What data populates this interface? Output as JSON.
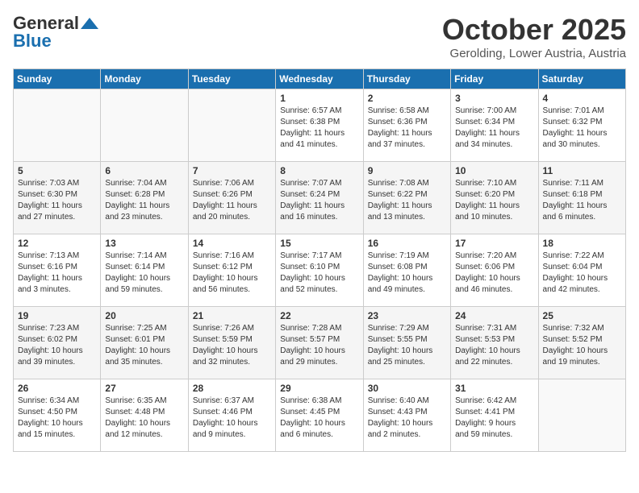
{
  "header": {
    "logo_line1": "General",
    "logo_line2": "Blue",
    "month": "October 2025",
    "location": "Gerolding, Lower Austria, Austria"
  },
  "days_of_week": [
    "Sunday",
    "Monday",
    "Tuesday",
    "Wednesday",
    "Thursday",
    "Friday",
    "Saturday"
  ],
  "weeks": [
    [
      {
        "day": "",
        "content": ""
      },
      {
        "day": "",
        "content": ""
      },
      {
        "day": "",
        "content": ""
      },
      {
        "day": "1",
        "content": "Sunrise: 6:57 AM\nSunset: 6:38 PM\nDaylight: 11 hours\nand 41 minutes."
      },
      {
        "day": "2",
        "content": "Sunrise: 6:58 AM\nSunset: 6:36 PM\nDaylight: 11 hours\nand 37 minutes."
      },
      {
        "day": "3",
        "content": "Sunrise: 7:00 AM\nSunset: 6:34 PM\nDaylight: 11 hours\nand 34 minutes."
      },
      {
        "day": "4",
        "content": "Sunrise: 7:01 AM\nSunset: 6:32 PM\nDaylight: 11 hours\nand 30 minutes."
      }
    ],
    [
      {
        "day": "5",
        "content": "Sunrise: 7:03 AM\nSunset: 6:30 PM\nDaylight: 11 hours\nand 27 minutes."
      },
      {
        "day": "6",
        "content": "Sunrise: 7:04 AM\nSunset: 6:28 PM\nDaylight: 11 hours\nand 23 minutes."
      },
      {
        "day": "7",
        "content": "Sunrise: 7:06 AM\nSunset: 6:26 PM\nDaylight: 11 hours\nand 20 minutes."
      },
      {
        "day": "8",
        "content": "Sunrise: 7:07 AM\nSunset: 6:24 PM\nDaylight: 11 hours\nand 16 minutes."
      },
      {
        "day": "9",
        "content": "Sunrise: 7:08 AM\nSunset: 6:22 PM\nDaylight: 11 hours\nand 13 minutes."
      },
      {
        "day": "10",
        "content": "Sunrise: 7:10 AM\nSunset: 6:20 PM\nDaylight: 11 hours\nand 10 minutes."
      },
      {
        "day": "11",
        "content": "Sunrise: 7:11 AM\nSunset: 6:18 PM\nDaylight: 11 hours\nand 6 minutes."
      }
    ],
    [
      {
        "day": "12",
        "content": "Sunrise: 7:13 AM\nSunset: 6:16 PM\nDaylight: 11 hours\nand 3 minutes."
      },
      {
        "day": "13",
        "content": "Sunrise: 7:14 AM\nSunset: 6:14 PM\nDaylight: 10 hours\nand 59 minutes."
      },
      {
        "day": "14",
        "content": "Sunrise: 7:16 AM\nSunset: 6:12 PM\nDaylight: 10 hours\nand 56 minutes."
      },
      {
        "day": "15",
        "content": "Sunrise: 7:17 AM\nSunset: 6:10 PM\nDaylight: 10 hours\nand 52 minutes."
      },
      {
        "day": "16",
        "content": "Sunrise: 7:19 AM\nSunset: 6:08 PM\nDaylight: 10 hours\nand 49 minutes."
      },
      {
        "day": "17",
        "content": "Sunrise: 7:20 AM\nSunset: 6:06 PM\nDaylight: 10 hours\nand 46 minutes."
      },
      {
        "day": "18",
        "content": "Sunrise: 7:22 AM\nSunset: 6:04 PM\nDaylight: 10 hours\nand 42 minutes."
      }
    ],
    [
      {
        "day": "19",
        "content": "Sunrise: 7:23 AM\nSunset: 6:02 PM\nDaylight: 10 hours\nand 39 minutes."
      },
      {
        "day": "20",
        "content": "Sunrise: 7:25 AM\nSunset: 6:01 PM\nDaylight: 10 hours\nand 35 minutes."
      },
      {
        "day": "21",
        "content": "Sunrise: 7:26 AM\nSunset: 5:59 PM\nDaylight: 10 hours\nand 32 minutes."
      },
      {
        "day": "22",
        "content": "Sunrise: 7:28 AM\nSunset: 5:57 PM\nDaylight: 10 hours\nand 29 minutes."
      },
      {
        "day": "23",
        "content": "Sunrise: 7:29 AM\nSunset: 5:55 PM\nDaylight: 10 hours\nand 25 minutes."
      },
      {
        "day": "24",
        "content": "Sunrise: 7:31 AM\nSunset: 5:53 PM\nDaylight: 10 hours\nand 22 minutes."
      },
      {
        "day": "25",
        "content": "Sunrise: 7:32 AM\nSunset: 5:52 PM\nDaylight: 10 hours\nand 19 minutes."
      }
    ],
    [
      {
        "day": "26",
        "content": "Sunrise: 6:34 AM\nSunset: 4:50 PM\nDaylight: 10 hours\nand 15 minutes."
      },
      {
        "day": "27",
        "content": "Sunrise: 6:35 AM\nSunset: 4:48 PM\nDaylight: 10 hours\nand 12 minutes."
      },
      {
        "day": "28",
        "content": "Sunrise: 6:37 AM\nSunset: 4:46 PM\nDaylight: 10 hours\nand 9 minutes."
      },
      {
        "day": "29",
        "content": "Sunrise: 6:38 AM\nSunset: 4:45 PM\nDaylight: 10 hours\nand 6 minutes."
      },
      {
        "day": "30",
        "content": "Sunrise: 6:40 AM\nSunset: 4:43 PM\nDaylight: 10 hours\nand 2 minutes."
      },
      {
        "day": "31",
        "content": "Sunrise: 6:42 AM\nSunset: 4:41 PM\nDaylight: 9 hours\nand 59 minutes."
      },
      {
        "day": "",
        "content": ""
      }
    ]
  ]
}
